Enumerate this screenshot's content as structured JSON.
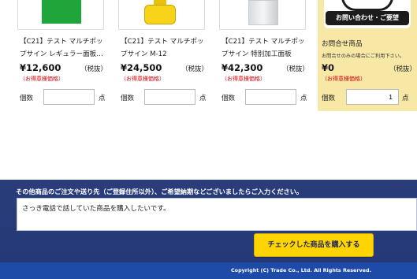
{
  "products": [
    {
      "name_line1": "【C21】テスト マルチポッ",
      "name_line2": "プサイン レギュラー面板…",
      "price": "¥12,600",
      "tax": "（税抜）",
      "note": "（お得意様価格）",
      "qty_label": "個数",
      "qty_unit": "点",
      "image": "green-signboard"
    },
    {
      "name_line1": "【C21】テスト マルチポッ",
      "name_line2": "プサイン M-12",
      "price": "¥24,500",
      "tax": "（税抜）",
      "note": "（お得意様価格）",
      "qty_label": "個数",
      "qty_unit": "点",
      "image": "yellow-water-tank"
    },
    {
      "name_line1": "【C21】テスト マルチポッ",
      "name_line2": "プサイン 特別加工面板",
      "price": "¥42,300",
      "tax": "（税抜）",
      "note": "（お得意様価格）",
      "qty_label": "個数",
      "qty_unit": "点",
      "image": "clear-panel"
    }
  ],
  "inquiry": {
    "banner_text": "お問い合わせ・ご要望",
    "title": "お問合せ商品",
    "description": "お問合せのみの場合にご利用下さい。",
    "price": "¥0",
    "tax": "（税抜）",
    "note": "（お得意様価格）",
    "qty_label": "個数",
    "qty_value": "1",
    "qty_unit": "点",
    "bg_color": "#f8e8a6"
  },
  "order": {
    "heading": "その他商品のご注文や送り先（ご登録住所以外）、ご希望納期などございましたらご入力ください。",
    "message": "さっき電話で話していた商品を購入したいです。",
    "submit_label": "チェックした商品を購入する",
    "bg_color": "#243777",
    "button_color": "#ffd400"
  },
  "footer": {
    "copyright": "Copyright (C) Trade Co., Ltd. All Rights Reserved.",
    "bg_color": "#1e4aa8"
  }
}
